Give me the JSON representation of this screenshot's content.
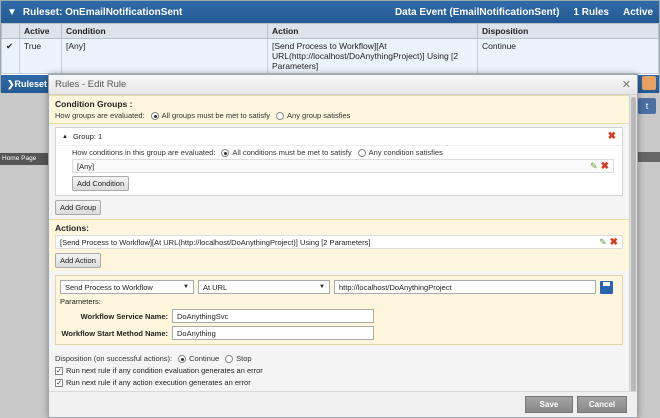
{
  "ruleset": {
    "title": "Ruleset: OnEmailNotificationSent",
    "event": "Data Event (EmailNotificationSent)",
    "rules_count": "1 Rules",
    "status": "Active",
    "columns": [
      "Active",
      "Condition",
      "Action",
      "Disposition"
    ],
    "row": {
      "active": "True",
      "condition": "[Any]",
      "action": "[Send Process to Workflow][At URL(http://localhost/DoAnythingProject)] Using [2 Parameters]",
      "disposition": "Continue"
    },
    "second_header": "Ruleset",
    "left_nav_text": "Home Page"
  },
  "dialog": {
    "title": "Rules - Edit Rule",
    "condition_groups": {
      "title": "Condition Groups :",
      "eval_label": "How groups are evaluated:",
      "option_all": "All groups must be met to satisfy",
      "option_any": "Any group satisfies",
      "group_label": "Group: 1",
      "inner_eval_label": "How conditions in this group are evaluated:",
      "inner_option_all": "All conditions must be met to satisfy",
      "inner_option_any": "Any condition satisfies",
      "condition_value": "[Any]",
      "add_condition": "Add Condition",
      "add_group": "Add Group"
    },
    "actions": {
      "title": "Actions:",
      "action_text": "[Send Process to Workflow][At URL(http://localhost/DoAnythingProject)] Using [2 Parameters]",
      "add_action": "Add Action",
      "action_type": "Send Process to Workflow",
      "location_type": "At URL",
      "url_value": "http://localhost/DoAnythingProject",
      "parameters_label": "Parameters:",
      "params": [
        {
          "label": "Workflow Service Name:",
          "value": "DoAnythingSvc"
        },
        {
          "label": "Workflow Start Method Name:",
          "value": "DoAnything"
        }
      ]
    },
    "disposition": {
      "label": "Disposition (on successful actions):",
      "option_continue": "Continue",
      "option_stop": "Stop",
      "check_condition_error": "Run next rule if any condition evaluation generates an error",
      "check_action_error": "Run next rule if any action execution generates an error"
    },
    "footer": {
      "save": "Save",
      "cancel": "Cancel"
    }
  },
  "colors": {
    "header_blue": "#2f6aa8",
    "yellow_section": "#fdf6dc",
    "delete_red": "#d83a20",
    "save_blue": "#2a63b0"
  }
}
